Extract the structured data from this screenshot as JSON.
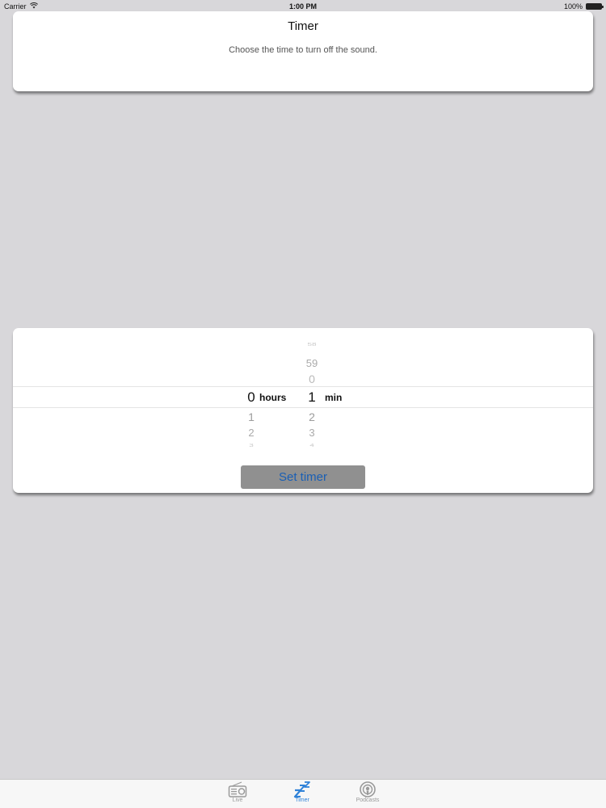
{
  "status_bar": {
    "carrier": "Carrier",
    "time": "1:00 PM",
    "battery": "100%"
  },
  "header_card": {
    "title": "Timer",
    "subtitle": "Choose the time to turn off the sound."
  },
  "picker": {
    "hours": {
      "above": [],
      "selected": "0",
      "below": [
        "1",
        "2",
        "3"
      ],
      "unit": "hours"
    },
    "minutes": {
      "above": [
        "58",
        "59",
        "0"
      ],
      "selected": "1",
      "below": [
        "2",
        "3",
        "4"
      ],
      "unit": "min"
    }
  },
  "set_timer_label": "Set timer",
  "tab_bar": {
    "tabs": [
      {
        "label": "Live",
        "icon": "radio-icon",
        "active": false
      },
      {
        "label": "Timer",
        "icon": "sleep-zzz-icon",
        "active": true
      },
      {
        "label": "Podcasts",
        "icon": "podcast-icon",
        "active": false
      }
    ]
  },
  "colors": {
    "background": "#d8d7da",
    "accent": "#2f82d8",
    "button_bg": "#909090",
    "button_text": "#1a5fb4"
  }
}
